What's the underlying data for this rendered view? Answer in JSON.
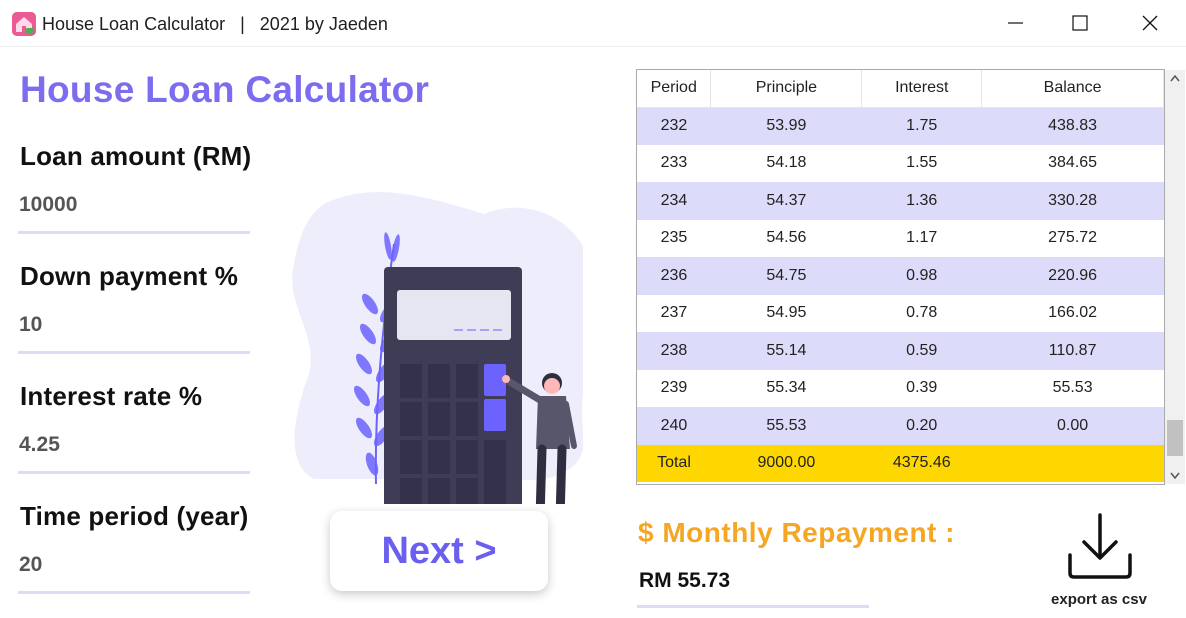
{
  "window": {
    "title": "House Loan Calculator   |   2021 by Jaeden",
    "icon": "house-app-icon",
    "controls": [
      "minimize-icon",
      "maximize-icon",
      "close-icon"
    ]
  },
  "form": {
    "heading": "House Loan Calculator",
    "loan_amount": {
      "label": "Loan amount (RM)",
      "value": "10000"
    },
    "down_payment": {
      "label": "Down payment %",
      "value": "10"
    },
    "interest_rate": {
      "label": "Interest rate %",
      "value": "4.25"
    },
    "time_period": {
      "label": "Time period (year)",
      "value": "20"
    },
    "next_button": "Next >"
  },
  "schedule": {
    "columns": [
      "Period",
      "Principle",
      "Interest",
      "Balance"
    ],
    "rows": [
      [
        "232",
        "53.99",
        "1.75",
        "438.83"
      ],
      [
        "233",
        "54.18",
        "1.55",
        "384.65"
      ],
      [
        "234",
        "54.37",
        "1.36",
        "330.28"
      ],
      [
        "235",
        "54.56",
        "1.17",
        "275.72"
      ],
      [
        "236",
        "54.75",
        "0.98",
        "220.96"
      ],
      [
        "237",
        "54.95",
        "0.78",
        "166.02"
      ],
      [
        "238",
        "55.14",
        "0.59",
        "110.87"
      ],
      [
        "239",
        "55.34",
        "0.39",
        "55.53"
      ],
      [
        "240",
        "55.53",
        "0.20",
        "0.00"
      ]
    ],
    "total": [
      "Total",
      "9000.00",
      "4375.46",
      ""
    ]
  },
  "result": {
    "monthly_label": "$ Monthly Repayment :",
    "monthly_value": "RM 55.73"
  },
  "export": {
    "label": "export as csv",
    "icon": "download-icon"
  },
  "colors": {
    "accent": "#7b6cf0",
    "row_alt": "#dcdcfa",
    "total_row": "#ffd700",
    "monthly_label": "#f5a623"
  }
}
